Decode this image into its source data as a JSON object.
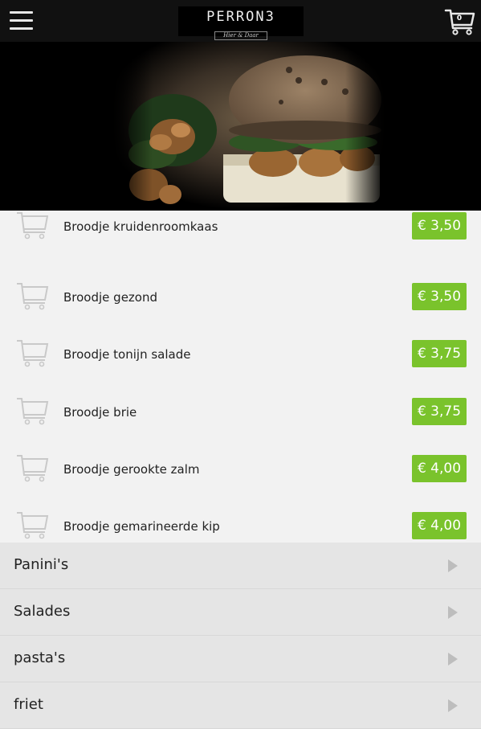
{
  "header": {
    "logo_text": "PERRON3",
    "logo_subtext": "Hier & Daar",
    "cart_count": "0",
    "menu_icon": "hamburger-icon",
    "cart_icon": "shopping-cart-icon"
  },
  "products": [
    {
      "name": "Broodje kruidenroomkaas",
      "price": "€ 3,50"
    },
    {
      "name": "Broodje gezond",
      "price": "€ 3,50"
    },
    {
      "name": "Broodje tonijn salade",
      "price": "€ 3,75"
    },
    {
      "name": "Broodje brie",
      "price": "€ 3,75"
    },
    {
      "name": "Broodje gerookte zalm",
      "price": "€ 4,00"
    },
    {
      "name": "Broodje gemarineerde kip",
      "price": "€ 4,00"
    }
  ],
  "categories": [
    {
      "label": "Panini's"
    },
    {
      "label": "Salades"
    },
    {
      "label": "pasta's"
    },
    {
      "label": "friet"
    }
  ],
  "colors": {
    "topbar": "#111111",
    "price_badge": "#7ac32c",
    "list_background": "#f2f2f2",
    "category_background": "#e5e5e5"
  }
}
